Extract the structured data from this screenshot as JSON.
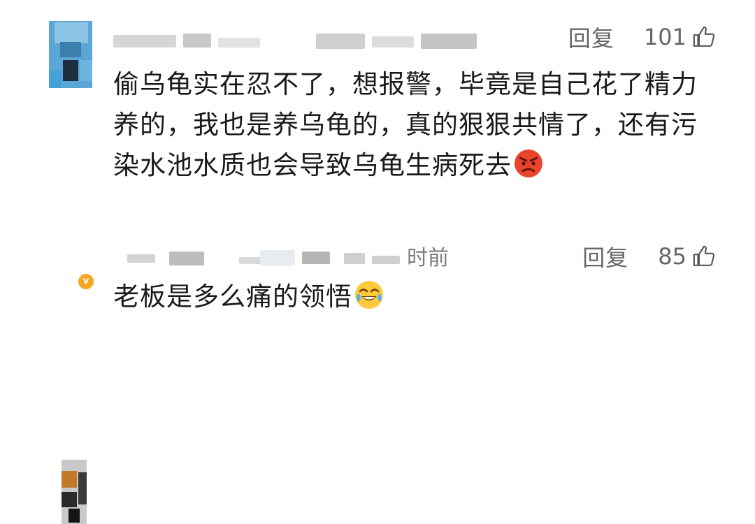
{
  "comments": [
    {
      "reply_label": "回复",
      "like_count": "101",
      "time_tail": "",
      "text": "偷乌龟实在忍不了，想报警，毕竟是自己花了精力养的，我也是养乌龟的，真的狠狠共情了，还有污染水池水质也会导致乌龟生病死去",
      "emoji": "angry-face-emoji"
    },
    {
      "reply_label": "回复",
      "like_count": "85",
      "time_tail": "时前",
      "text": "老板是多么痛的领悟",
      "emoji": "crying-laughing-face-emoji"
    }
  ],
  "colors": {
    "text": "#1a1a1a",
    "meta": "#7a7a7a",
    "verified_badge": "#f5a623"
  }
}
